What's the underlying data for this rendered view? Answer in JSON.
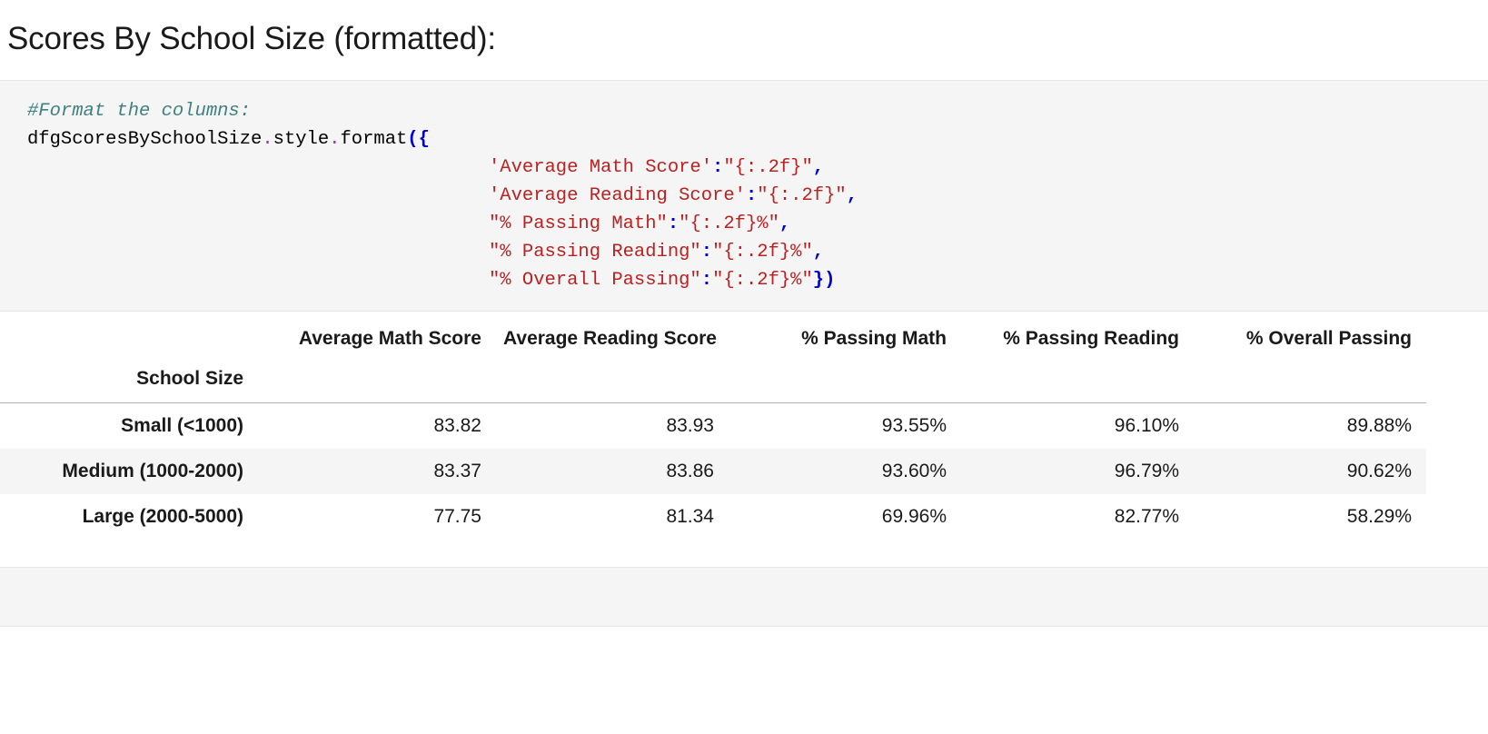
{
  "page": {
    "title": "Scores By School Size (formatted):"
  },
  "code_cell": {
    "comment": "#Format the columns:",
    "object_name": "dfgScoresBySchoolSize",
    "dot1": ".",
    "attr_style": "style",
    "dot2": ".",
    "attr_format": "format",
    "open_paren_brace": "({",
    "entries": [
      {
        "key": "'Average Math Score'",
        "colon": ":",
        "value": "\"{:.2f}\"",
        "trail": ","
      },
      {
        "key": "'Average Reading Score'",
        "colon": ":",
        "value": "\"{:.2f}\"",
        "trail": ","
      },
      {
        "key": "\"% Passing Math\"",
        "colon": ":",
        "value": "\"{:.2f}%\"",
        "trail": ","
      },
      {
        "key": "\"% Passing Reading\"",
        "colon": ":",
        "value": "\"{:.2f}%\"",
        "trail": ","
      },
      {
        "key": "\"% Overall Passing\"",
        "colon": ":",
        "value": "\"{:.2f}%\"",
        "trail": "})"
      }
    ]
  },
  "table": {
    "index_name": "School Size",
    "columns": [
      "Average Math Score",
      "Average Reading Score",
      "% Passing Math",
      "% Passing Reading",
      "% Overall Passing"
    ],
    "rows": [
      {
        "label": "Small (<1000)",
        "cells": [
          "83.82",
          "83.93",
          "93.55%",
          "96.10%",
          "89.88%"
        ]
      },
      {
        "label": "Medium (1000-2000)",
        "cells": [
          "83.37",
          "83.86",
          "93.60%",
          "96.79%",
          "90.62%"
        ]
      },
      {
        "label": "Large (2000-5000)",
        "cells": [
          "77.75",
          "81.34",
          "69.96%",
          "82.77%",
          "58.29%"
        ]
      }
    ]
  },
  "chart_data": {
    "type": "table",
    "title": "Scores By School Size (formatted)",
    "index_name": "School Size",
    "categories": [
      "Small (<1000)",
      "Medium (1000-2000)",
      "Large (2000-5000)"
    ],
    "columns": [
      "Average Math Score",
      "Average Reading Score",
      "% Passing Math",
      "% Passing Reading",
      "% Overall Passing"
    ],
    "series": [
      {
        "name": "Average Math Score",
        "values": [
          83.82,
          83.37,
          77.75
        ]
      },
      {
        "name": "Average Reading Score",
        "values": [
          83.93,
          83.86,
          81.34
        ]
      },
      {
        "name": "% Passing Math",
        "values": [
          93.55,
          93.6,
          69.96
        ]
      },
      {
        "name": "% Passing Reading",
        "values": [
          96.1,
          96.79,
          82.77
        ]
      },
      {
        "name": "% Overall Passing",
        "values": [
          89.88,
          90.62,
          58.29
        ]
      }
    ]
  },
  "colors": {
    "cell_background": "#f5f5f5",
    "comment": "#408080",
    "string": "#ba2121",
    "punctuation": "#0000cf",
    "operator_dot": "#a020f0",
    "text": "#1a1a1a",
    "rule": "#b0b0b0"
  }
}
